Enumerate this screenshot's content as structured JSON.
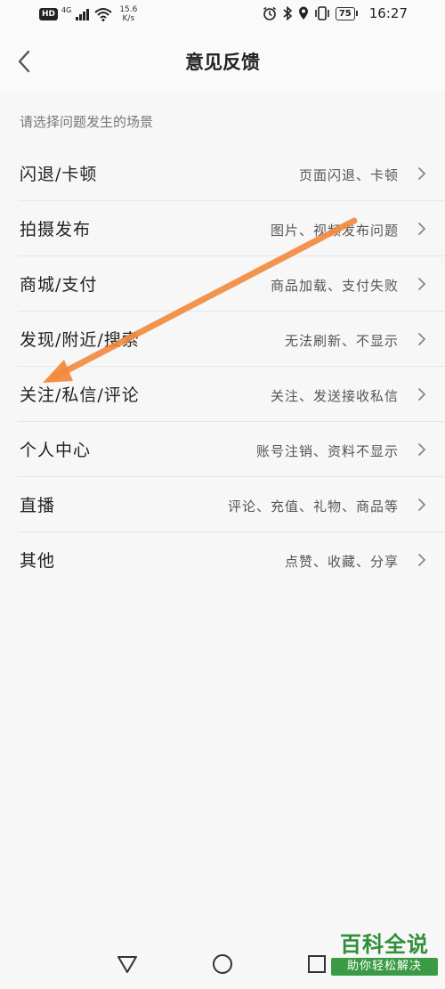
{
  "status_bar": {
    "hd": "HD",
    "signal_type": "4G",
    "net_speed_value": "15.6",
    "net_speed_unit": "K/s",
    "battery": "75",
    "time": "16:27"
  },
  "header": {
    "title": "意见反馈"
  },
  "hint": "请选择问题发生的场景",
  "items": [
    {
      "label": "闪退/卡顿",
      "desc": "页面闪退、卡顿"
    },
    {
      "label": "拍摄发布",
      "desc": "图片、视频发布问题"
    },
    {
      "label": "商城/支付",
      "desc": "商品加载、支付失败"
    },
    {
      "label": "发现/附近/搜索",
      "desc": "无法刷新、不显示"
    },
    {
      "label": "关注/私信/评论",
      "desc": "关注、发送接收私信"
    },
    {
      "label": "个人中心",
      "desc": "账号注销、资料不显示"
    },
    {
      "label": "直播",
      "desc": "评论、充值、礼物、商品等"
    },
    {
      "label": "其他",
      "desc": "点赞、收藏、分享"
    }
  ],
  "annotation": {
    "color": "#f28a3c"
  },
  "watermark": {
    "title": "百科全说",
    "subtitle": "助你轻松解决"
  },
  "colors": {
    "background": "#f7f7f7",
    "divider": "#e6e6e6",
    "watermark_green": "#2f8f3a"
  }
}
